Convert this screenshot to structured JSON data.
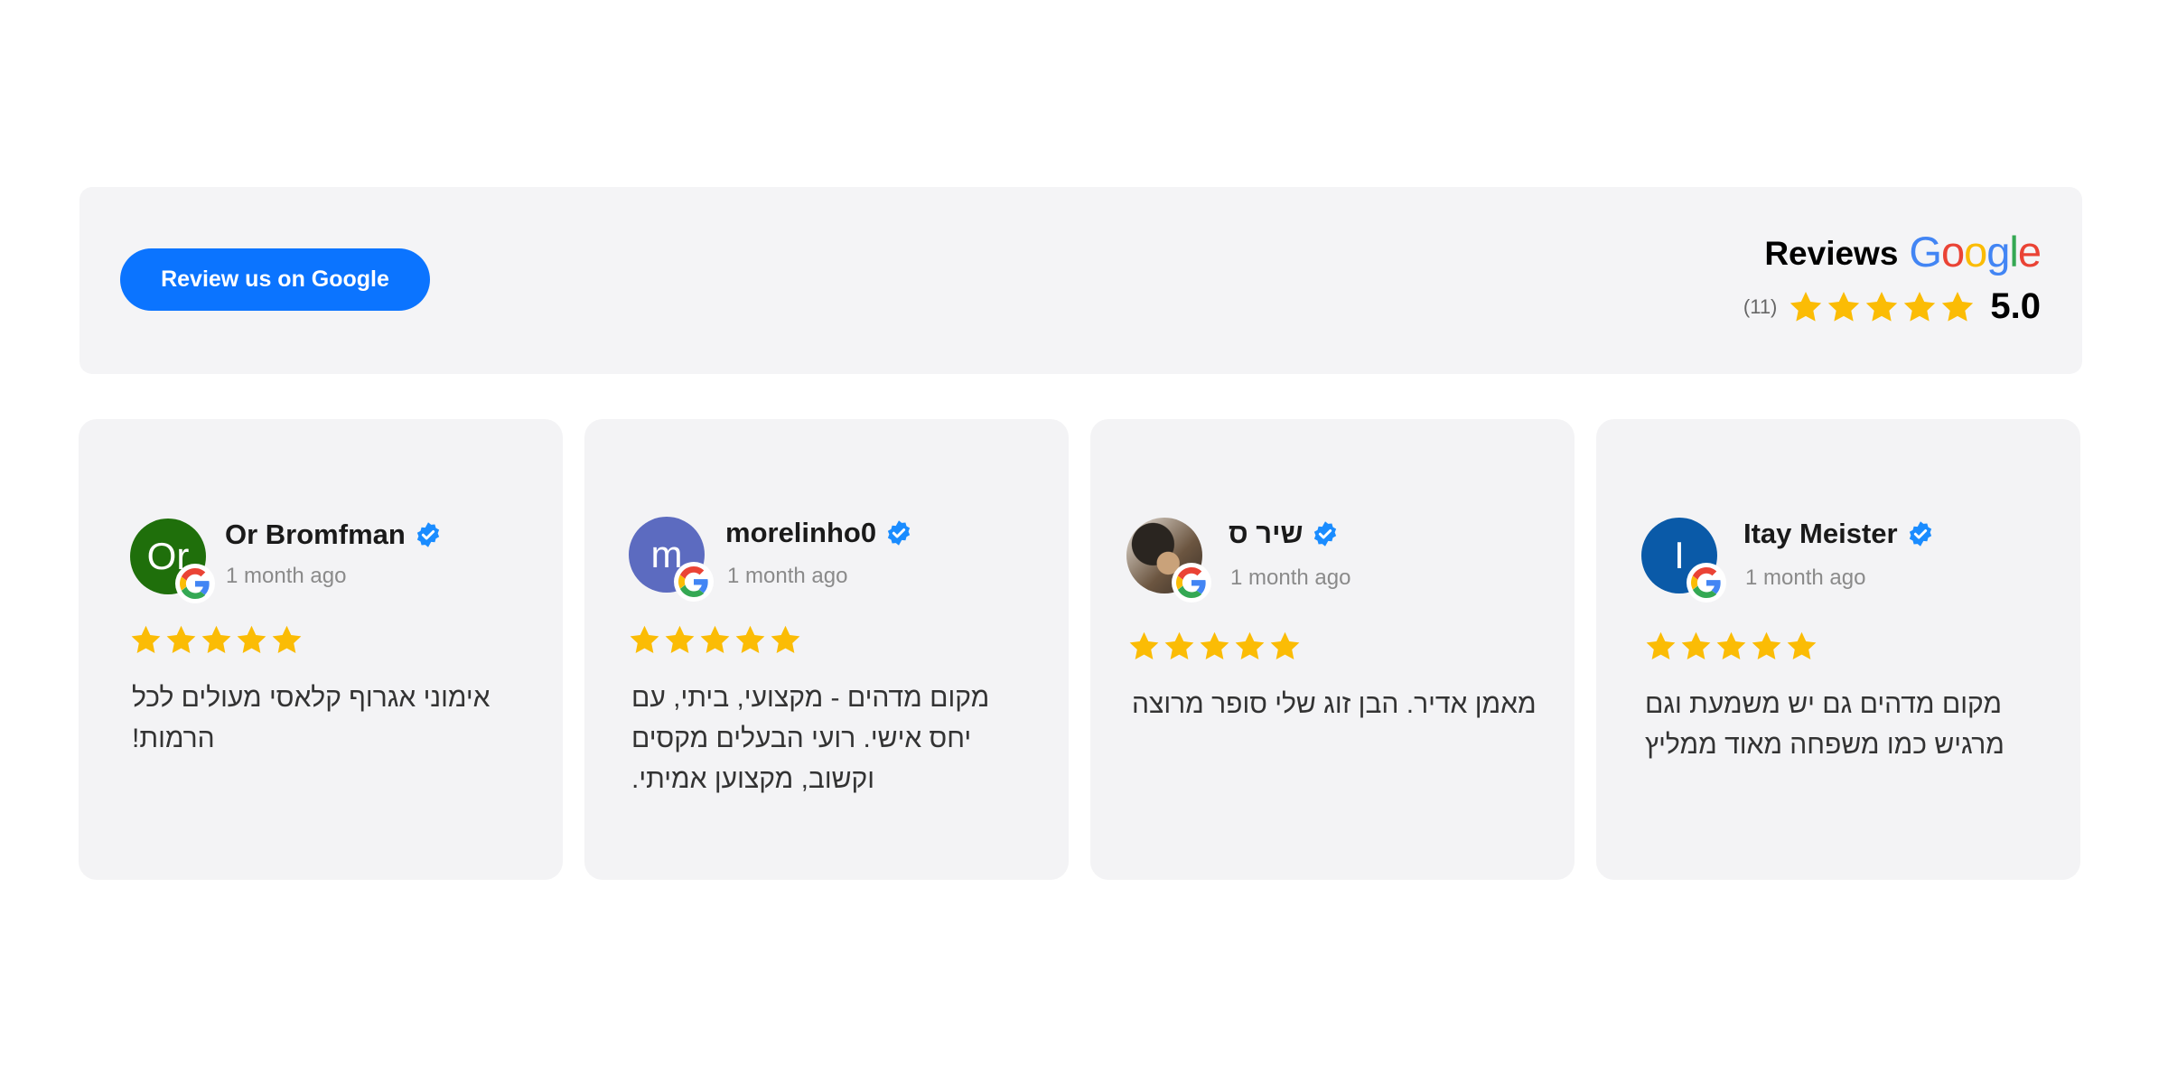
{
  "header": {
    "review_button": "Review us on Google",
    "reviews_label": "Reviews",
    "google_letters": [
      {
        "ch": "G",
        "color": "#4285F4"
      },
      {
        "ch": "o",
        "color": "#EA4335"
      },
      {
        "ch": "o",
        "color": "#FBBC05"
      },
      {
        "ch": "g",
        "color": "#4285F4"
      },
      {
        "ch": "l",
        "color": "#34A853"
      },
      {
        "ch": "e",
        "color": "#EA4335"
      }
    ],
    "count": "(11)",
    "rating": "5.0",
    "stars": 5
  },
  "colors": {
    "star": "#FBBC05",
    "button": "#0b74ff",
    "verified": "#1a8cff",
    "card_bg": "#f3f3f5"
  },
  "reviews": [
    {
      "name": "Or Bromfman",
      "initials": "Or",
      "avatar_color": "#1f6f0b",
      "avatar_type": "initials",
      "time": "1 month ago",
      "stars": 5,
      "text": "אימוני אגרוף קלאסי מעולים לכל הרמות!",
      "icons": [
        "google-badge-icon",
        "verified-icon",
        "star-icon"
      ]
    },
    {
      "name": "morelinho0",
      "initials": "m",
      "avatar_color": "#5c6bc0",
      "avatar_type": "initials",
      "time": "1 month ago",
      "stars": 5,
      "text": "מקום מדהים - מקצועי, ביתי, עם יחס אישי. רועי הבעלים מקסים וקשוב, מקצוען אמיתי.",
      "icons": [
        "google-badge-icon",
        "verified-icon",
        "star-icon"
      ]
    },
    {
      "name": "שיר ס",
      "initials": "",
      "avatar_color": "#6b5540",
      "avatar_type": "photo",
      "time": "1 month ago",
      "stars": 5,
      "text": "מאמן אדיר. הבן זוג שלי סופר מרוצה",
      "icons": [
        "google-badge-icon",
        "verified-icon",
        "star-icon"
      ]
    },
    {
      "name": "Itay Meister",
      "initials": "I",
      "avatar_color": "#0a5aa8",
      "avatar_type": "initials",
      "time": "1 month ago",
      "stars": 5,
      "text": "מקום מדהים גם יש משמעת וגם מרגיש כמו משפחה מאוד ממליץ",
      "icons": [
        "google-badge-icon",
        "verified-icon",
        "star-icon"
      ]
    }
  ]
}
